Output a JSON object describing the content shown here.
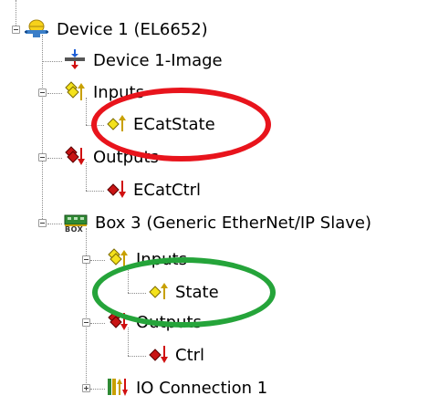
{
  "tree": {
    "device": {
      "label": "Device 1 (EL6652)",
      "icon": "ethernet-device-icon"
    },
    "device_image": {
      "label": "Device 1-Image",
      "icon": "device-image-icon"
    },
    "device_inputs": {
      "label": "Inputs",
      "icon": "inputs-folder-icon"
    },
    "ecat_state": {
      "label": "ECatState",
      "icon": "input-variable-icon"
    },
    "device_outputs": {
      "label": "Outputs",
      "icon": "outputs-folder-icon"
    },
    "ecat_ctrl": {
      "label": "ECatCtrl",
      "icon": "output-variable-icon"
    },
    "box": {
      "label": "Box 3 (Generic EtherNet/IP Slave)",
      "icon": "box-icon",
      "badge": "BOX"
    },
    "box_inputs": {
      "label": "Inputs",
      "icon": "inputs-folder-icon"
    },
    "state": {
      "label": "State",
      "icon": "input-variable-icon"
    },
    "box_outputs": {
      "label": "Outputs",
      "icon": "outputs-folder-icon"
    },
    "ctrl": {
      "label": "Ctrl",
      "icon": "output-variable-icon"
    },
    "io_connection": {
      "label": "IO Connection 1",
      "icon": "io-connection-icon"
    }
  },
  "highlights": {
    "ecat_state_color": "#e8141c",
    "state_color": "#25a43a"
  },
  "colors": {
    "input_arrow": "#c8a000",
    "output_arrow": "#d01010",
    "yellow": "#f4e21c",
    "red": "#c81414"
  }
}
